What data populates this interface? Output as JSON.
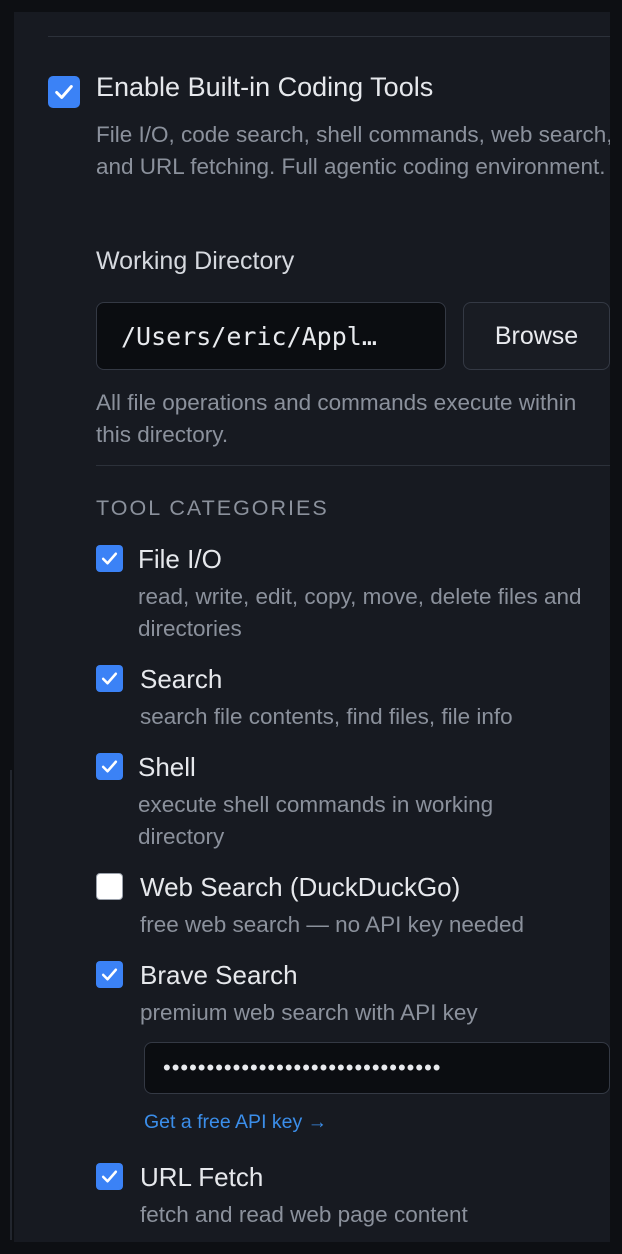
{
  "settings": {
    "enable_tools": {
      "label": "Enable Built-in Coding Tools",
      "checked": true,
      "description": "File I/O, code search, shell commands, web search, and URL fetching. Full agentic coding environment."
    },
    "working_directory": {
      "label": "Working Directory",
      "value": "/Users/eric/Appl…",
      "browse_label": "Browse",
      "help": "All file operations and commands execute within this directory."
    },
    "tool_categories": {
      "label": "TOOL CATEGORIES",
      "items": [
        {
          "name": "File I/O",
          "description": "read, write, edit, copy, move, delete files and directories",
          "checked": true
        },
        {
          "name": "Search",
          "description": "search file contents, find files, file info",
          "checked": true
        },
        {
          "name": "Shell",
          "description": "execute shell commands in working directory",
          "checked": true
        },
        {
          "name": "Web Search (DuckDuckGo)",
          "description": "free web search — no API key needed",
          "checked": false
        },
        {
          "name": "Brave Search",
          "description": "premium web search with API key",
          "checked": true
        },
        {
          "name": "URL Fetch",
          "description": "fetch and read web page content",
          "checked": true
        }
      ]
    },
    "brave_api_key": {
      "masked_value": "••••••••••••••••••••••••••••••••",
      "link_label": "Get a free API key →"
    }
  },
  "colors": {
    "accent": "#3b82f6",
    "link": "#3b8eea",
    "background": "#171a21"
  },
  "icons": {
    "checkbox_checked": "checkmark-icon"
  }
}
